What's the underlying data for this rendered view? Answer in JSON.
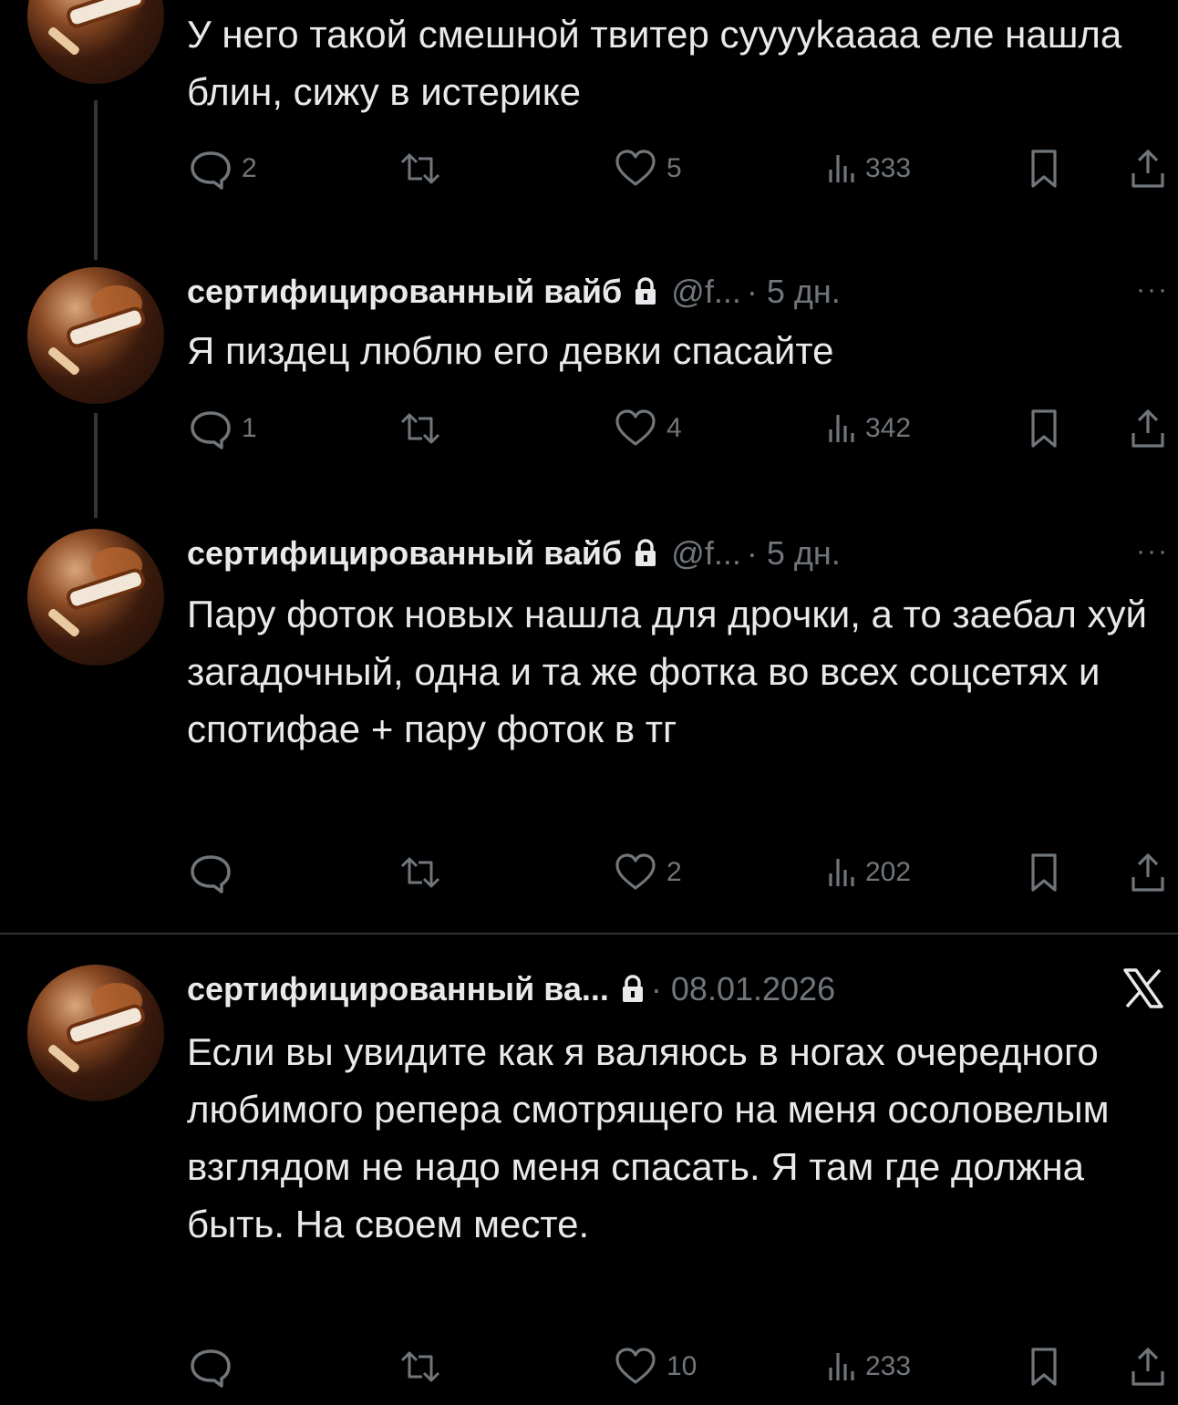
{
  "colors": {
    "background": "#000000",
    "text": "#e7e9ea",
    "muted": "#71767b",
    "divider": "#2f3336"
  },
  "tweets": [
    {
      "name": "",
      "handle": "",
      "time": "",
      "text": "У него такой смешной твитер сууууkаааа еле нашла блин, сижу в истерике",
      "replies": "2",
      "retweets": "",
      "likes": "5",
      "views": "333"
    },
    {
      "name": "сертифицированный вайб",
      "handle": "@f...",
      "time": "· 5 дн.",
      "text": "Я пиздец люблю его девки спасайте",
      "replies": "1",
      "retweets": "",
      "likes": "4",
      "views": "342"
    },
    {
      "name": "сертифицированный вайб",
      "handle": "@f...",
      "time": "· 5 дн.",
      "text": "Пару фоток новых нашла для дрочки, а то заебал хуй загадочный, одна и та же фотка во всех соцсетях и спотифае + пару фоток в тг",
      "replies": "",
      "retweets": "",
      "likes": "2",
      "views": "202"
    },
    {
      "name": "сертифицированный ва...",
      "handle": "",
      "time": "· 08.01.2026",
      "text": "Если вы увидите как я валяюсь в ногах очередного любимого репера смотрящего на меня осоловелым взглядом не надо меня спасать. Я там где должна быть. На своем месте.",
      "replies": "",
      "retweets": "",
      "likes": "10",
      "views": "233"
    }
  ],
  "icons": {
    "reply": "reply-icon",
    "retweet": "retweet-icon",
    "like": "heart-icon",
    "views": "views-icon",
    "bookmark": "bookmark-icon",
    "share": "share-icon",
    "lock": "lock-icon",
    "more": "more-icon",
    "x_logo": "x-logo-icon"
  },
  "more_label": "···"
}
